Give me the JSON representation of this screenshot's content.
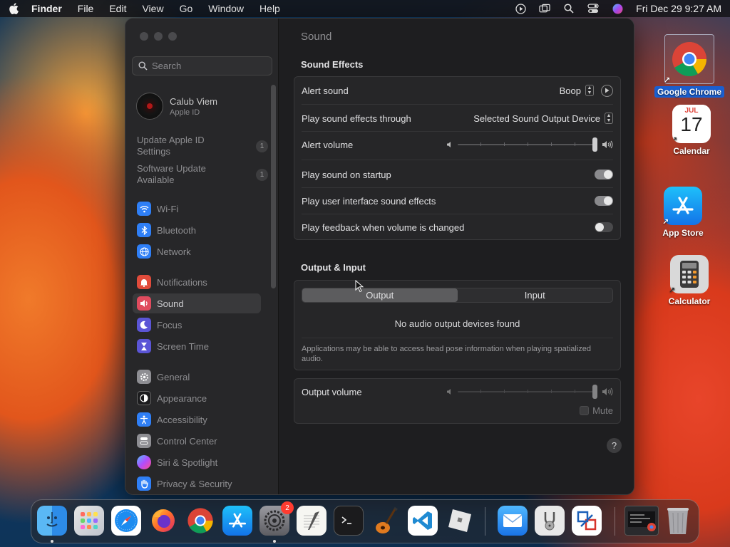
{
  "menubar": {
    "app": "Finder",
    "items": [
      "File",
      "Edit",
      "View",
      "Go",
      "Window",
      "Help"
    ],
    "clock": "Fri Dec 29  9:27 AM"
  },
  "sidebar": {
    "search_placeholder": "Search",
    "account": {
      "name": "Calub Viem",
      "sub": "Apple ID"
    },
    "notices": [
      {
        "text": "Update Apple ID Settings",
        "badge": "1"
      },
      {
        "text": "Software Update Available",
        "badge": "1"
      }
    ],
    "items": [
      {
        "label": "Wi-Fi",
        "icon": "wifi-icon",
        "color": "#2f7ff6"
      },
      {
        "label": "Bluetooth",
        "icon": "bluetooth-icon",
        "color": "#2f7ff6"
      },
      {
        "label": "Network",
        "icon": "globe-icon",
        "color": "#2f7ff6"
      },
      {
        "label": "Notifications",
        "icon": "bell-icon",
        "color": "#e04b3b"
      },
      {
        "label": "Sound",
        "icon": "speaker-icon",
        "color": "#e04b5e"
      },
      {
        "label": "Focus",
        "icon": "moon-icon",
        "color": "#5b55d6"
      },
      {
        "label": "Screen Time",
        "icon": "hourglass-icon",
        "color": "#5b55d6"
      },
      {
        "label": "General",
        "icon": "gear-icon",
        "color": "#8e8e93"
      },
      {
        "label": "Appearance",
        "icon": "appearance-icon",
        "color": "#1c1c1e"
      },
      {
        "label": "Accessibility",
        "icon": "accessibility-icon",
        "color": "#2f7ff6"
      },
      {
        "label": "Control Center",
        "icon": "control-center-icon",
        "color": "#8e8e93"
      },
      {
        "label": "Siri & Spotlight",
        "icon": "siri-icon",
        "color": "#c2408d"
      },
      {
        "label": "Privacy & Security",
        "icon": "hand-icon",
        "color": "#2f7ff6"
      }
    ]
  },
  "main": {
    "title": "Sound",
    "sound_effects": {
      "heading": "Sound Effects",
      "alert_sound": {
        "label": "Alert sound",
        "value": "Boop"
      },
      "play_through": {
        "label": "Play sound effects through",
        "value": "Selected Sound Output Device"
      },
      "alert_volume": {
        "label": "Alert volume",
        "level": 1.0
      },
      "startup": {
        "label": "Play sound on startup",
        "on": true
      },
      "ui_effects": {
        "label": "Play user interface sound effects",
        "on": true
      },
      "feedback": {
        "label": "Play feedback when volume is changed",
        "on": false
      }
    },
    "output_input": {
      "heading": "Output & Input",
      "tabs": [
        "Output",
        "Input"
      ],
      "selected_tab": "Output",
      "empty": "No audio output devices found",
      "helper": "Applications may be able to access head pose information when playing spatialized audio."
    },
    "output_volume": {
      "label": "Output volume",
      "level": 1.0,
      "mute_label": "Mute"
    },
    "help": "?"
  },
  "desktop": {
    "icons": [
      {
        "label": "Google Chrome",
        "selected": true
      },
      {
        "label": "Calendar",
        "month": "JUL",
        "day": "17"
      },
      {
        "label": "App Store"
      },
      {
        "label": "Calculator"
      }
    ]
  },
  "dock": {
    "settings_badge": "2"
  }
}
